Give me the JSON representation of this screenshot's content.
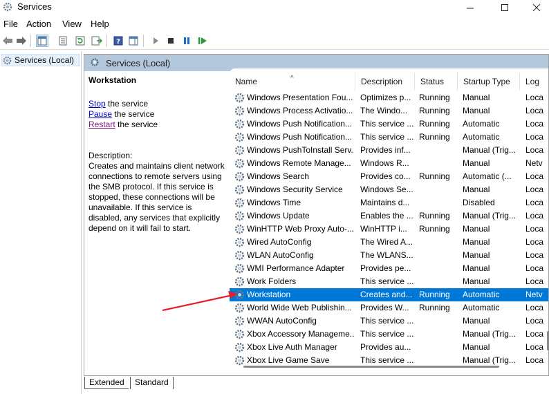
{
  "window": {
    "title": "Services",
    "minimize_icon": "minimize-icon",
    "maximize_icon": "maximize-icon",
    "close_icon": "close-icon"
  },
  "menu": [
    "File",
    "Action",
    "View",
    "Help"
  ],
  "tree": {
    "root": "Services (Local)"
  },
  "pane": {
    "header": "Services (Local)"
  },
  "detail": {
    "title": "Workstation",
    "stop_link": "Stop",
    "stop_rest": " the service",
    "pause_link": "Pause",
    "pause_rest": " the service",
    "restart_link": "Restart",
    "restart_rest": " the service",
    "description_label": "Description:",
    "description": "Creates and maintains client network connections to remote servers using the SMB protocol. If this service is stopped, these connections will be unavailable. If this service is disabled, any services that explicitly depend on it will fail to start."
  },
  "columns": [
    "Name",
    "Description",
    "Status",
    "Startup Type",
    "Log"
  ],
  "rows": [
    {
      "name": "Windows Presentation Fou...",
      "desc": "Optimizes p...",
      "status": "Running",
      "startup": "Manual",
      "log": "Loca"
    },
    {
      "name": "Windows Process Activatio...",
      "desc": "The Windo...",
      "status": "Running",
      "startup": "Manual",
      "log": "Loca"
    },
    {
      "name": "Windows Push Notification...",
      "desc": "This service ...",
      "status": "Running",
      "startup": "Automatic",
      "log": "Loca"
    },
    {
      "name": "Windows Push Notification...",
      "desc": "This service ...",
      "status": "Running",
      "startup": "Automatic",
      "log": "Loca"
    },
    {
      "name": "Windows PushToInstall Serv...",
      "desc": "Provides inf...",
      "status": "",
      "startup": "Manual (Trig...",
      "log": "Loca"
    },
    {
      "name": "Windows Remote Manage...",
      "desc": "Windows R...",
      "status": "",
      "startup": "Manual",
      "log": "Netv"
    },
    {
      "name": "Windows Search",
      "desc": "Provides co...",
      "status": "Running",
      "startup": "Automatic (...",
      "log": "Loca"
    },
    {
      "name": "Windows Security Service",
      "desc": "Windows Se...",
      "status": "",
      "startup": "Manual",
      "log": "Loca"
    },
    {
      "name": "Windows Time",
      "desc": "Maintains d...",
      "status": "",
      "startup": "Disabled",
      "log": "Loca"
    },
    {
      "name": "Windows Update",
      "desc": "Enables the ...",
      "status": "Running",
      "startup": "Manual (Trig...",
      "log": "Loca"
    },
    {
      "name": "WinHTTP Web Proxy Auto-...",
      "desc": "WinHTTP i...",
      "status": "Running",
      "startup": "Manual",
      "log": "Loca"
    },
    {
      "name": "Wired AutoConfig",
      "desc": "The Wired A...",
      "status": "",
      "startup": "Manual",
      "log": "Loca"
    },
    {
      "name": "WLAN AutoConfig",
      "desc": "The WLANS...",
      "status": "",
      "startup": "Manual",
      "log": "Loca"
    },
    {
      "name": "WMI Performance Adapter",
      "desc": "Provides pe...",
      "status": "",
      "startup": "Manual",
      "log": "Loca"
    },
    {
      "name": "Work Folders",
      "desc": "This service ...",
      "status": "",
      "startup": "Manual",
      "log": "Loca"
    },
    {
      "name": "Workstation",
      "desc": "Creates and...",
      "status": "Running",
      "startup": "Automatic",
      "log": "Netv"
    },
    {
      "name": "World Wide Web Publishin...",
      "desc": "Provides W...",
      "status": "Running",
      "startup": "Automatic",
      "log": "Loca"
    },
    {
      "name": "WWAN AutoConfig",
      "desc": "This service ...",
      "status": "",
      "startup": "Manual",
      "log": "Loca"
    },
    {
      "name": "Xbox Accessory Manageme...",
      "desc": "This service ...",
      "status": "",
      "startup": "Manual (Trig...",
      "log": "Loca"
    },
    {
      "name": "Xbox Live Auth Manager",
      "desc": "Provides au...",
      "status": "",
      "startup": "Manual",
      "log": "Loca"
    },
    {
      "name": "Xbox Live Game Save",
      "desc": "This service ...",
      "status": "",
      "startup": "Manual (Trig...",
      "log": "Loca"
    }
  ],
  "selected_row": 15,
  "tabs": [
    "Extended",
    "Standard"
  ],
  "colors": {
    "selection": "#0078d7",
    "pane_header": "#b4c8dc",
    "link": "#0000cc",
    "annotation_arrow": "#e0202a"
  }
}
